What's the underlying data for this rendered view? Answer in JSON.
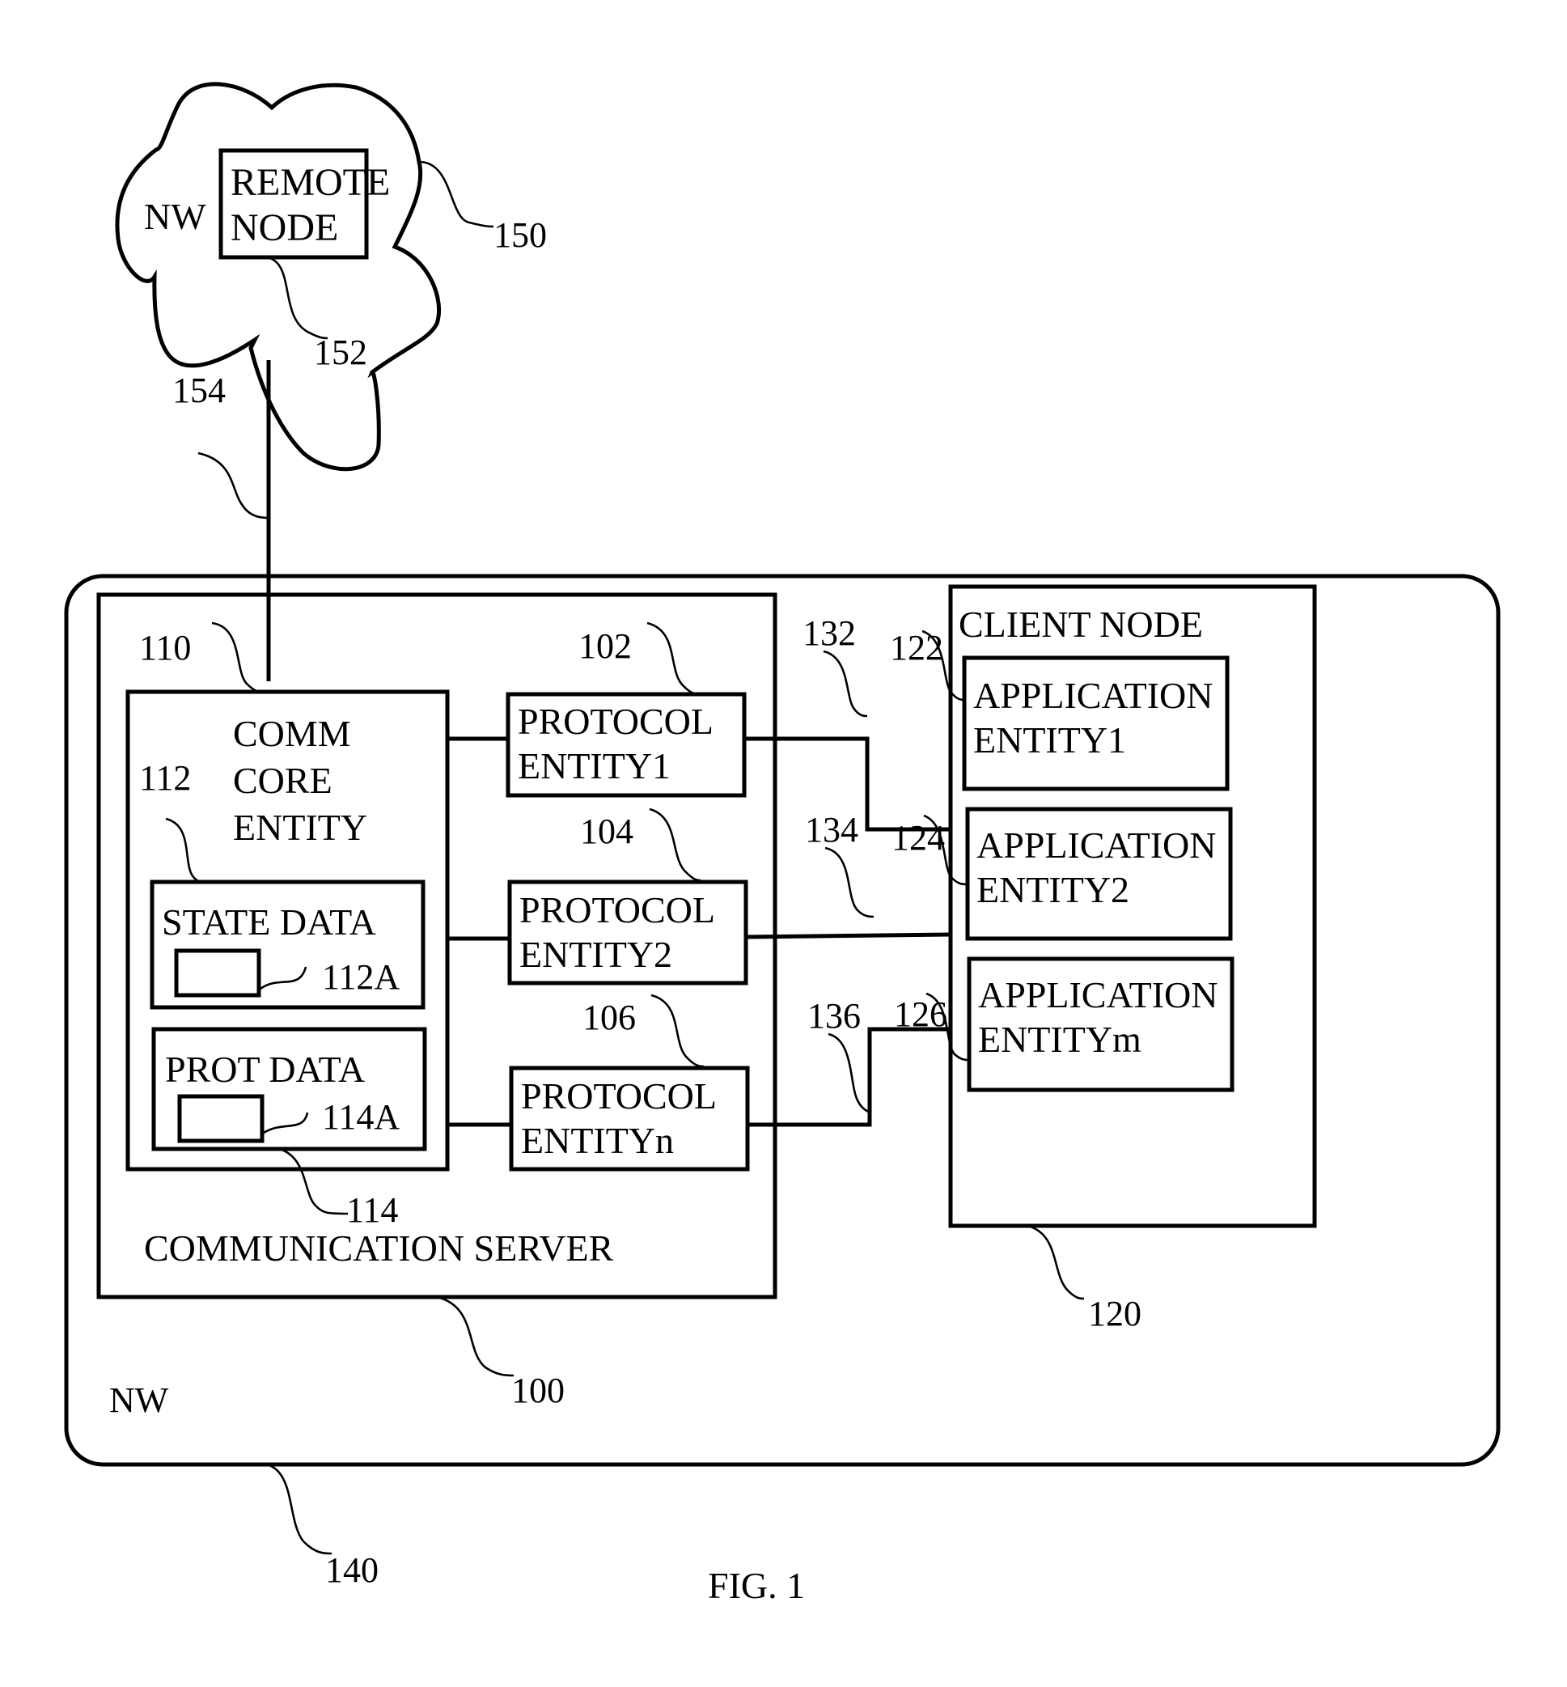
{
  "figure": {
    "caption": "FIG. 1",
    "type": "block-diagram"
  },
  "remote_network": {
    "label": "NW",
    "ref": "150",
    "remote_node": {
      "lines": [
        "REMOTE",
        "NODE"
      ],
      "ref": "152"
    },
    "link_ref": "154"
  },
  "local_network": {
    "label": "NW",
    "ref": "140"
  },
  "communication_server": {
    "label": "COMMUNICATION SERVER",
    "ref": "100",
    "comm_core_entity": {
      "lines": [
        "COMM",
        "CORE",
        "ENTITY"
      ],
      "ref": "110",
      "state_data": {
        "label": "STATE DATA",
        "ref": "112",
        "item_ref": "112A"
      },
      "prot_data": {
        "label": "PROT DATA",
        "ref": "114",
        "item_ref": "114A"
      }
    },
    "protocol_entities": [
      {
        "lines": [
          "PROTOCOL",
          "ENTITY1"
        ],
        "ref": "102"
      },
      {
        "lines": [
          "PROTOCOL",
          "ENTITY2"
        ],
        "ref": "104"
      },
      {
        "lines": [
          "PROTOCOL",
          "ENTITYn"
        ],
        "ref": "106"
      }
    ]
  },
  "client_node": {
    "label": "CLIENT NODE",
    "ref": "120",
    "application_entities": [
      {
        "lines": [
          "APPLICATION",
          "ENTITY1"
        ],
        "ref": "122"
      },
      {
        "lines": [
          "APPLICATION",
          "ENTITY2"
        ],
        "ref": "124"
      },
      {
        "lines": [
          "APPLICATION",
          "ENTITYm"
        ],
        "ref": "126"
      }
    ]
  },
  "connections": [
    {
      "from": "PROTOCOL ENTITY1",
      "to": "APPLICATION ENTITY1",
      "ref": "132"
    },
    {
      "from": "PROTOCOL ENTITY2",
      "to": "APPLICATION ENTITY2",
      "ref": "134"
    },
    {
      "from": "PROTOCOL ENTITYn",
      "to": "APPLICATION ENTITYm",
      "ref": "136"
    }
  ]
}
